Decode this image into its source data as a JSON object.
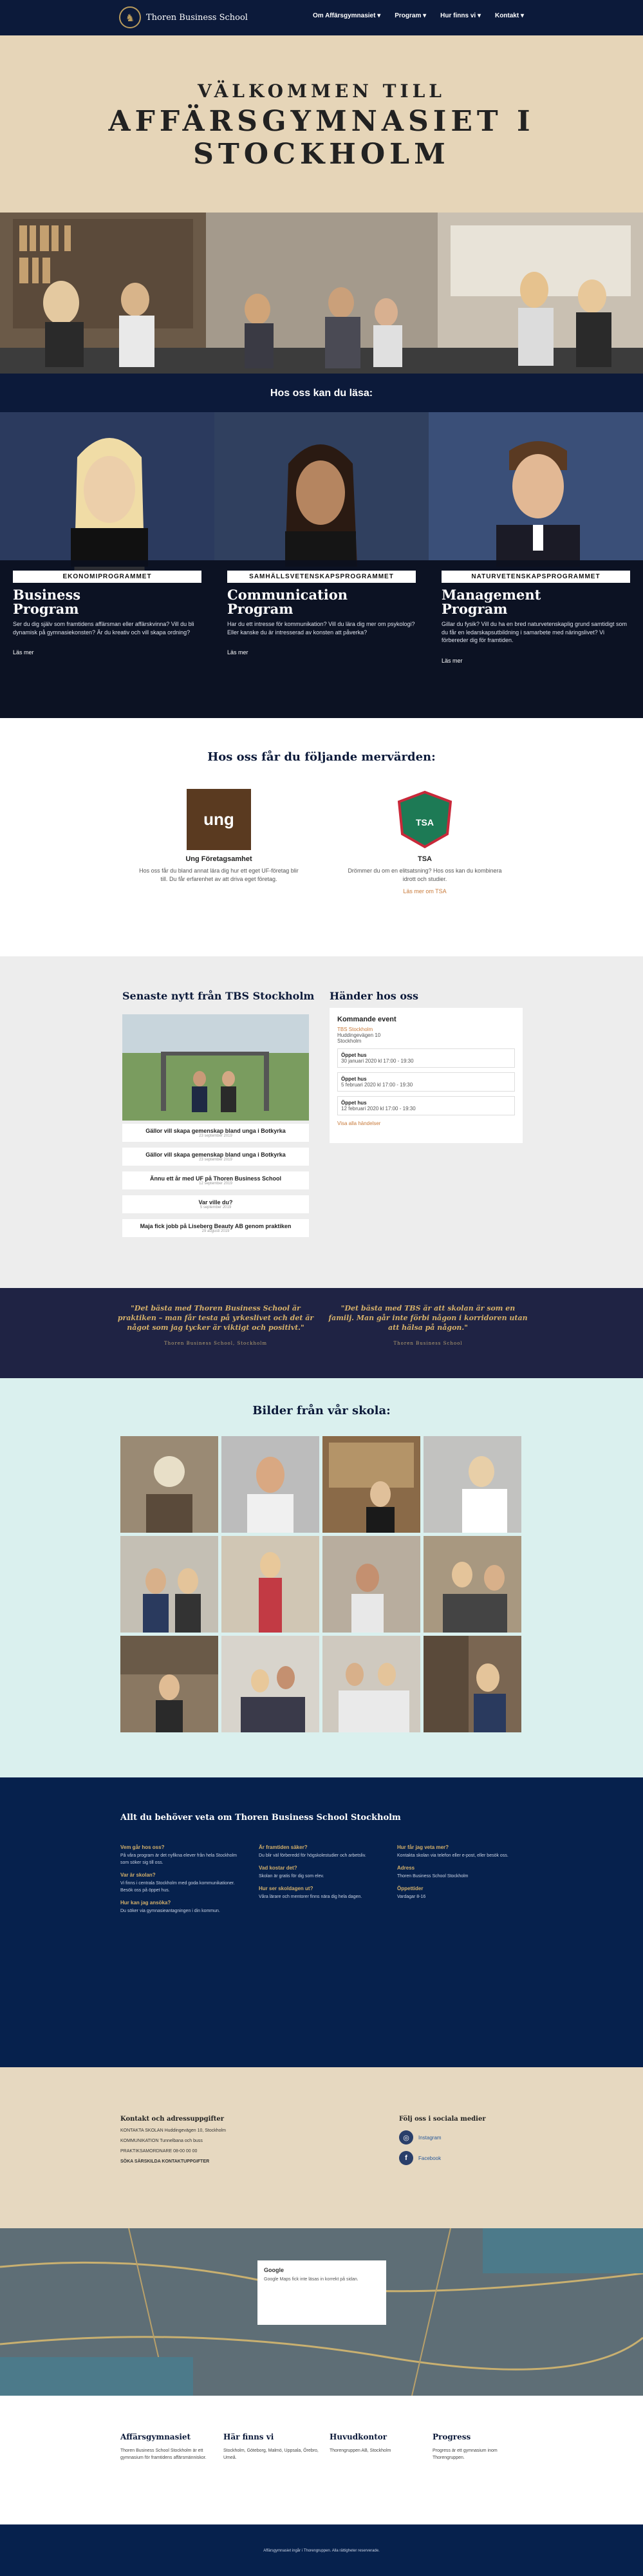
{
  "header": {
    "logo_text": "Thoren Business School",
    "nav": [
      "Om Affärsgymnasiet ▾",
      "Program ▾",
      "Hur finns vi ▾",
      "Kontakt ▾"
    ]
  },
  "hero": {
    "line1": "VÄLKOMMEN TILL",
    "line2": "AFFÄRSGYMNASIET I",
    "line3": "STOCKHOLM"
  },
  "programs_heading": "Hos oss kan du läsa:",
  "programs": [
    {
      "tag": "EKONOMIPROGRAMMET",
      "name1": "Business",
      "name2": "Program",
      "desc": "Ser du dig själv som framtidens affärsman eller affärskvinna? Vill du bli dynamisk på gymnasiekonsten? Är du kreativ och vill skapa ordning?",
      "more": "Läs mer"
    },
    {
      "tag": "SAMHÄLLSVETENSKAPSPROGRAMMET",
      "name1": "Communication",
      "name2": "Program",
      "desc": "Har du ett intresse för kommunikation? Vill du lära dig mer om psykologi? Eller kanske du är intresserad av konsten att påverka?",
      "more": "Läs mer"
    },
    {
      "tag": "NATURVETENSKAPSPROGRAMMET",
      "name1": "Management",
      "name2": "Program",
      "desc": "Gillar du fysik? Vill du ha en bred naturvetenskaplig grund samtidigt som du får en ledarskapsutbildning i samarbete med näringslivet? Vi förbereder dig för framtiden.",
      "more": "Läs mer"
    }
  ],
  "values": {
    "heading": "Hos oss får du följande mervärden:",
    "items": [
      {
        "logo": "ung",
        "title": "Ung Företagsamhet",
        "desc": "Hos oss får du bland annat lära dig hur ett eget UF-företag blir till. Du får erfarenhet av att driva eget företag."
      },
      {
        "logo": "TSA",
        "title": "TSA",
        "desc": "Drömmer du om en elitsatsning? Hos oss kan du kombinera idrott och studier.",
        "link": "Läs mer om TSA"
      }
    ]
  },
  "news": {
    "heading": "Senaste nytt från TBS Stockholm",
    "items": [
      {
        "title": "Gällor vill skapa gemenskap bland unga i Botkyrka",
        "date": "23 september 2019"
      },
      {
        "title": "Gällor vill skapa gemenskap bland unga i Botkyrka",
        "date": "23 september 2019"
      },
      {
        "title": "Ännu ett år med UF på Thoren Business School",
        "date": "12 september 2019"
      },
      {
        "title": "Var ville du?",
        "date": "5 september 2019"
      },
      {
        "title": "Maja fick jobb på Liseberg Beauty AB genom praktiken",
        "date": "29 augusti 2019"
      }
    ]
  },
  "events": {
    "heading": "Händer hos oss",
    "sub": "Kommande event",
    "venue_link": "TBS Stockholm",
    "address": "Huddingevägen 10",
    "city": "Stockholm",
    "items": [
      {
        "title": "Öppet hus",
        "time": "30 januari 2020 kl 17:00 - 19:30"
      },
      {
        "title": "Öppet hus",
        "time": "5 februari 2020 kl 17:00 - 19:30"
      },
      {
        "title": "Öppet hus",
        "time": "12 februari 2020 kl 17:00 - 19:30"
      }
    ],
    "all_link": "Visa alla händelser"
  },
  "quotes": [
    {
      "text": "\"Det bästa med Thoren Business School är praktiken – man får testa på yrkeslivet och det är något som jag tycker är viktigt och positivt.\"",
      "author": "Thoren Business School, Stockholm"
    },
    {
      "text": "\"Det bästa med TBS är att skolan är som en familj. Man går inte förbi någon i korridoren utan att hälsa på någon.\"",
      "author": "Thoren Business School"
    }
  ],
  "gallery_heading": "Bilder från vår skola:",
  "faq": {
    "heading": "Allt du behöver veta om Thoren Business School Stockholm",
    "cols": [
      [
        {
          "q": "Vem går hos oss?",
          "a": "På våra program är det nyfikna elever från hela Stockholm som söker sig till oss."
        },
        {
          "q": "Var är skolan?",
          "a": "Vi finns i centrala Stockholm med goda kommunikationer. Besök oss på öppet hus."
        },
        {
          "q": "Hur kan jag ansöka?",
          "a": "Du söker via gymnasieantagningen i din kommun."
        }
      ],
      [
        {
          "q": "Är framtiden säker?",
          "a": "Du blir väl förberedd för högskolestudier och arbetsliv."
        },
        {
          "q": "Vad kostar det?",
          "a": "Skolan är gratis för dig som elev."
        },
        {
          "q": "Hur ser skoldagen ut?",
          "a": "Våra lärare och mentorer finns nära dig hela dagen."
        }
      ],
      [
        {
          "q": "Hur får jag veta mer?",
          "a": "Kontakta skolan via telefon eller e-post, eller besök oss."
        },
        {
          "q": "Adress",
          "a": "Thoren Business School Stockholm"
        },
        {
          "q": "Öppettider",
          "a": "Vardagar 8-16"
        }
      ]
    ]
  },
  "contact": {
    "heading": "Kontakt och adressuppgifter",
    "lines": [
      "KONTAKTA SKOLAN Huddingevägen 10, Stockholm",
      "KOMMUNIKATION Tunnelbana och buss",
      "PRAKTIKSAMORDNARE 08-00 00 00",
      "SÖKA SÄRSKILDA KONTAKTUPPGIFTER"
    ],
    "social_heading": "Följ oss i sociala medier",
    "social": [
      "Instagram",
      "Facebook"
    ]
  },
  "map_card": {
    "title": "Google",
    "text": "Google Maps fick inte läsas in korrekt på sidan."
  },
  "footer": {
    "cols": [
      {
        "title": "Affärsgymnasiet",
        "text": "Thoren Business School Stockholm är ett gymnasium för framtidens affärsmänniskor."
      },
      {
        "title": "Här finns vi",
        "text": "Stockholm, Göteborg, Malmö, Uppsala, Örebro, Umeå."
      },
      {
        "title": "Huvudkontor",
        "text": "Thorengruppen AB, Stockholm"
      },
      {
        "title": "Progress",
        "text": "Progress är ett gymnasium inom Thorengruppen."
      }
    ],
    "bottom": "Affärsgymnasiet ingår i Thorengruppen. Alla rättigheter reserverade."
  }
}
